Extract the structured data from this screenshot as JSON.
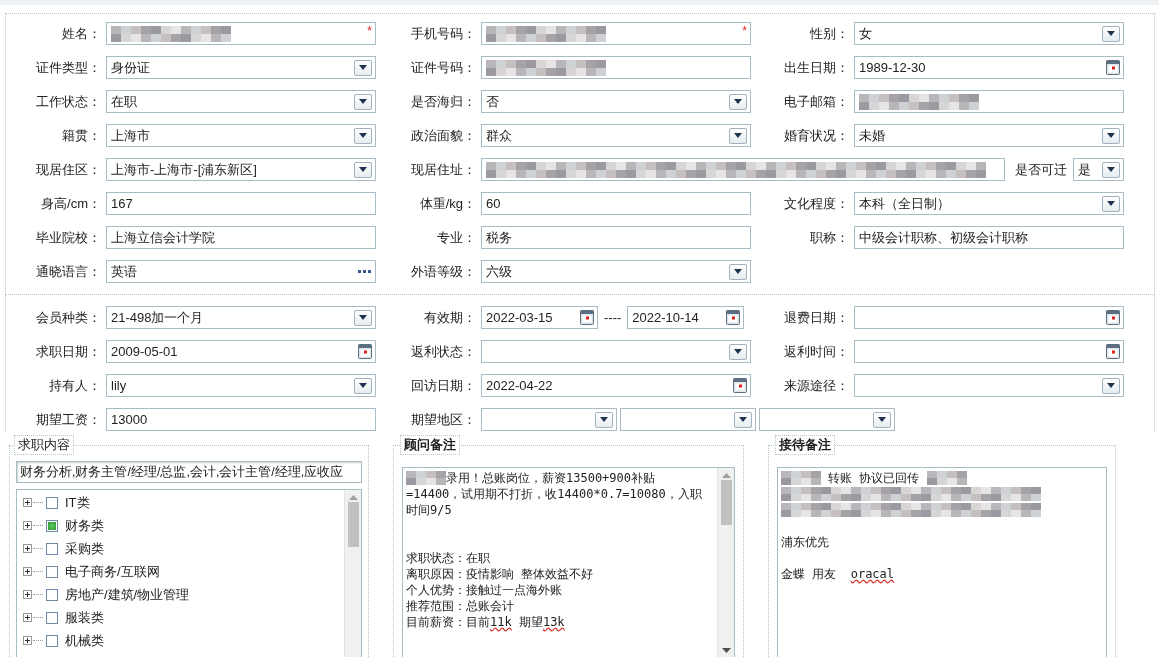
{
  "sections": [
    {
      "rows": [
        {
          "cells": [
            {
              "label": "姓名：",
              "kind": "text",
              "redacted": true,
              "required_mark": "*"
            },
            {
              "label": "手机号码：",
              "kind": "text",
              "redacted": true,
              "required_mark": "*"
            },
            {
              "label": "性别：",
              "kind": "select",
              "value": "女"
            }
          ]
        },
        {
          "cells": [
            {
              "label": "证件类型：",
              "kind": "select",
              "value": "身份证"
            },
            {
              "label": "证件号码：",
              "kind": "text",
              "redacted": true
            },
            {
              "label": "出生日期：",
              "kind": "date",
              "value": "1989-12-30"
            }
          ]
        },
        {
          "cells": [
            {
              "label": "工作状态：",
              "kind": "select",
              "value": "在职"
            },
            {
              "label": "是否海归：",
              "kind": "select",
              "value": "否"
            },
            {
              "label": "电子邮箱：",
              "kind": "text",
              "redacted": true
            }
          ]
        },
        {
          "cells": [
            {
              "label": "籍贯：",
              "kind": "select",
              "value": "上海市"
            },
            {
              "label": "政治面貌：",
              "kind": "select",
              "value": "群众"
            },
            {
              "label": "婚育状况：",
              "kind": "select",
              "value": "未婚"
            }
          ]
        },
        {
          "cells": [
            {
              "label": "现居住区：",
              "kind": "select",
              "value": " 上海市-上海市-[浦东新区]"
            },
            {
              "label": "现居住址：",
              "kind": "address",
              "redacted": true,
              "extra": {
                "label": "是否可迁",
                "value": "是"
              }
            }
          ]
        },
        {
          "cells": [
            {
              "label": "身高/cm：",
              "kind": "text",
              "value": "167"
            },
            {
              "label": "体重/kg：",
              "kind": "text",
              "value": "60"
            },
            {
              "label": "文化程度：",
              "kind": "select",
              "value": "本科（全日制）"
            }
          ]
        },
        {
          "cells": [
            {
              "label": "毕业院校：",
              "kind": "text",
              "value": "上海立信会计学院"
            },
            {
              "label": "专业：",
              "kind": "text",
              "value": "税务"
            },
            {
              "label": "职称：",
              "kind": "text",
              "value": "中级会计职称、初级会计职称"
            }
          ]
        },
        {
          "cells": [
            {
              "label": "通晓语言：",
              "kind": "picker",
              "value": "英语"
            },
            {
              "label": "外语等级：",
              "kind": "select",
              "value": "六级"
            }
          ]
        }
      ]
    },
    {
      "rows": [
        {
          "cells": [
            {
              "label": "会员种类：",
              "kind": "select",
              "value": "21-498加一个月"
            },
            {
              "label": "有效期：",
              "kind": "date_range",
              "from": "2022-03-15",
              "separator": "----",
              "to": "2022-10-14"
            },
            {
              "label": "退费日期：",
              "kind": "date"
            }
          ]
        },
        {
          "cells": [
            {
              "label": "求职日期：",
              "kind": "date",
              "value": "2009-05-01"
            },
            {
              "label": "返利状态：",
              "kind": "select"
            },
            {
              "label": "返利时间：",
              "kind": "date"
            }
          ]
        },
        {
          "cells": [
            {
              "label": "持有人：",
              "kind": "select",
              "value": "lily"
            },
            {
              "label": "回访日期：",
              "kind": "date",
              "value": "2022-04-22"
            },
            {
              "label": "来源途径：",
              "kind": "select"
            }
          ]
        },
        {
          "cells": [
            {
              "label": "期望工资：",
              "kind": "text",
              "value": "13000"
            },
            {
              "label": "期望地区：",
              "kind": "multi_select",
              "selects": [
                {
                  "kind": "select"
                },
                {
                  "kind": "select"
                },
                {
                  "kind": "select"
                }
              ]
            }
          ]
        }
      ]
    }
  ],
  "job_content": {
    "legend": "求职内容",
    "emphasized": false,
    "value": "财务分析,财务主管/经理/总监,会计,会计主管/经理,应收应",
    "tree": [
      {
        "label": "IT类",
        "checked": false,
        "expanded": false
      },
      {
        "label": "财务类",
        "checked": true,
        "expanded": false
      },
      {
        "label": "采购类",
        "checked": false,
        "expanded": false
      },
      {
        "label": "电子商务/互联网",
        "checked": false,
        "expanded": false
      },
      {
        "label": "房地产/建筑/物业管理",
        "checked": false,
        "expanded": false
      },
      {
        "label": "服装类",
        "checked": false,
        "expanded": false
      },
      {
        "label": "机械类",
        "checked": false,
        "expanded": false
      }
    ]
  },
  "notes": [
    {
      "legend": "顾问备注",
      "emphasized": true,
      "scrollbar": true,
      "lines": [
        {
          "kind": "text",
          "segments": [
            {
              "kind": "redacted",
              "whole_line": false
            },
            {
              "kind": "text",
              "text": "录用！总账岗位，薪资13500+900补贴"
            }
          ]
        },
        {
          "kind": "text",
          "segments": [
            {
              "kind": "text",
              "text": "=14400，试用期不打折，收14400*0.7=10080，入职"
            }
          ]
        },
        {
          "kind": "text",
          "segments": [
            {
              "kind": "text",
              "text": "时间9/5"
            }
          ]
        },
        {
          "kind": "blank"
        },
        {
          "kind": "blank"
        },
        {
          "kind": "text",
          "segments": [
            {
              "kind": "text",
              "text": "求职状态：在职"
            }
          ]
        },
        {
          "kind": "text",
          "segments": [
            {
              "kind": "text",
              "text": "离职原因：疫情影响 整体效益不好"
            }
          ]
        },
        {
          "kind": "text",
          "segments": [
            {
              "kind": "text",
              "text": "个人优势：接触过一点海外账"
            }
          ]
        },
        {
          "kind": "text",
          "segments": [
            {
              "kind": "text",
              "text": "推荐范围：总账会计"
            }
          ]
        },
        {
          "kind": "text",
          "segments": [
            {
              "kind": "text",
              "text": "目前薪资：目前"
            },
            {
              "kind": "misspelled",
              "text": "11k"
            },
            {
              "kind": "text",
              "text": " 期望"
            },
            {
              "kind": "misspelled",
              "text": "13k"
            }
          ]
        }
      ]
    },
    {
      "legend": "接待备注",
      "emphasized": true,
      "scrollbar": false,
      "lines": [
        {
          "kind": "text",
          "segments": [
            {
              "kind": "redacted",
              "whole_line": false
            },
            {
              "kind": "text",
              "text": " 转账 协议已回传 "
            },
            {
              "kind": "redacted",
              "whole_line": false
            }
          ]
        },
        {
          "kind": "text",
          "segments": [
            {
              "kind": "redacted",
              "whole_line": true
            }
          ]
        },
        {
          "kind": "text",
          "segments": [
            {
              "kind": "redacted",
              "whole_line": true
            }
          ]
        },
        {
          "kind": "blank"
        },
        {
          "kind": "text",
          "segments": [
            {
              "kind": "text",
              "text": "浦东优先"
            }
          ]
        },
        {
          "kind": "blank"
        },
        {
          "kind": "text",
          "segments": [
            {
              "kind": "text",
              "text": "金蝶 用友  "
            },
            {
              "kind": "misspelled",
              "text": "oracal"
            }
          ]
        }
      ]
    }
  ]
}
